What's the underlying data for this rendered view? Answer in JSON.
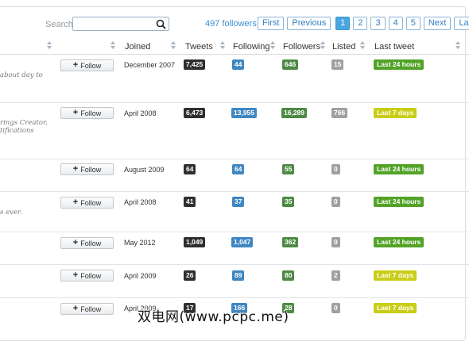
{
  "search": {
    "label": "Search",
    "value": "",
    "placeholder": ""
  },
  "followers_count": "497 followers",
  "pagination": [
    "First",
    "Previous",
    "1",
    "2",
    "3",
    "4",
    "5",
    "Next",
    "Last"
  ],
  "pagination_active": "1",
  "columns": [
    "Joined",
    "Tweets",
    "Following",
    "Followers",
    "Listed",
    "Last tweet"
  ],
  "follow_label": "Follow",
  "rows": [
    {
      "bio": [
        "about day to",
        ""
      ],
      "joined": "December 2007",
      "tweets": "7,425",
      "following": "44",
      "followers": "646",
      "listed": "15",
      "last_tweet": "Last 24 hours"
    },
    {
      "bio": [
        "rings Creator,",
        "tifications"
      ],
      "joined": "April 2008",
      "tweets": "6,473",
      "following": "13,955",
      "followers": "16,289",
      "listed": "766",
      "last_tweet": "Last 7 days"
    },
    {
      "bio": [
        "",
        ""
      ],
      "joined": "August 2009",
      "tweets": "64",
      "following": "64",
      "followers": "55",
      "listed": "0",
      "last_tweet": "Last 24 hours"
    },
    {
      "bio": [
        "s ever.",
        ""
      ],
      "joined": "April 2008",
      "tweets": "41",
      "following": "37",
      "followers": "35",
      "listed": "0",
      "last_tweet": "Last 24 hours"
    },
    {
      "bio": [
        "",
        ""
      ],
      "joined": "May 2012",
      "tweets": "1,049",
      "following": "1,047",
      "followers": "362",
      "listed": "0",
      "last_tweet": "Last 24 hours"
    },
    {
      "bio": [
        "",
        ""
      ],
      "joined": "April 2009",
      "tweets": "26",
      "following": "89",
      "followers": "80",
      "listed": "2",
      "last_tweet": "Last 7 days"
    },
    {
      "bio": [
        "",
        ""
      ],
      "joined": "April 2009",
      "tweets": "17",
      "following": "166",
      "followers": "28",
      "listed": "0",
      "last_tweet": "Last 7 days"
    }
  ],
  "watermark": "双电网(www.pcpc.me)",
  "colors": {
    "tweets_badge": "#2f2f2f",
    "following_badge": "#3f87c2",
    "followers_badge": "#4e8a45",
    "listed_badge": "#a0a0a0",
    "last_24h": "#52a327",
    "last_7d": "#c9cd17",
    "pager_active": "#49a6e0"
  }
}
